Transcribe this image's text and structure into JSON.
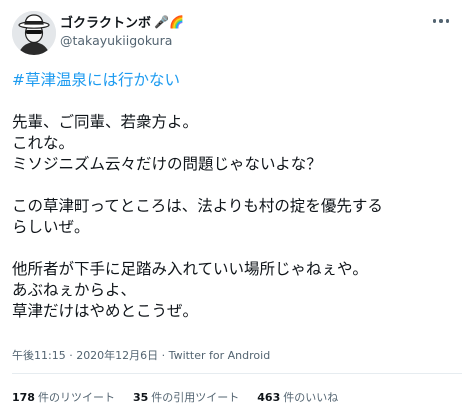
{
  "user": {
    "name": "ゴクラクトンボ",
    "name_emoji": "🎤🌈",
    "handle": "@takayukiigokura"
  },
  "tweet": {
    "hashtag": "#草津温泉には行かない",
    "lines": [
      "先輩、ご同輩、若衆方よ。",
      "これな。",
      "ミソジニズム云々だけの問題じゃないよな？",
      "",
      "この草津町ってところは、法よりも村の掟を優先する",
      "らしいぜ。",
      "",
      "他所者が下手に足踏み入れていい場所じゃねぇや。",
      "あぶねぇからよ、",
      "草津だけはやめとこうぜ。"
    ]
  },
  "meta": {
    "time_date": "午後11:15 · 2020年12月6日 · ",
    "app": "Twitter for Android"
  },
  "stats": {
    "retweets_num": "178",
    "retweets_label": "件のリツイート",
    "quotes_num": "35",
    "quotes_label": "件の引用ツイート",
    "likes_num": "463",
    "likes_label": "件のいいね"
  },
  "colors": {
    "accent": "#1d9bf0",
    "text": "#0f1419",
    "secondary": "#536471"
  }
}
